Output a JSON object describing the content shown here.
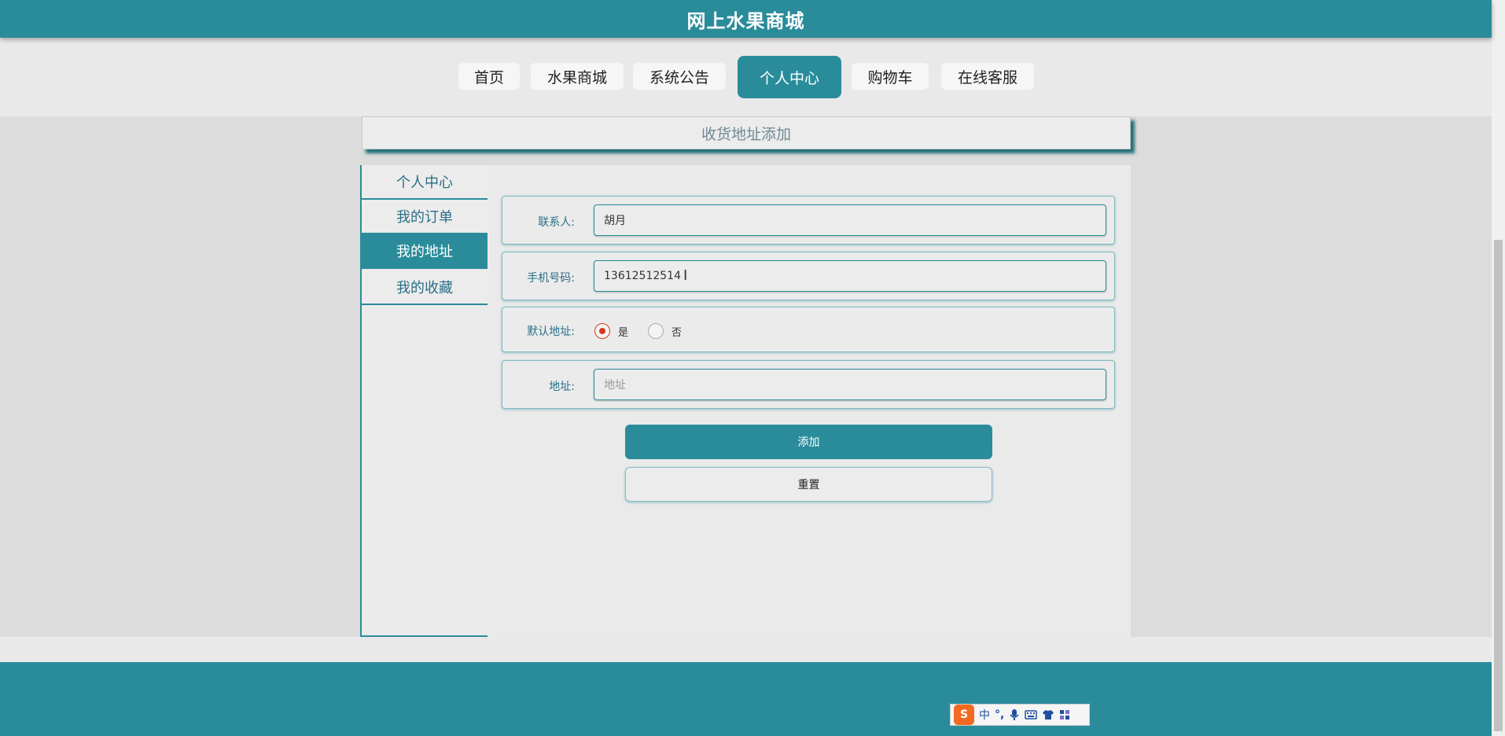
{
  "app": {
    "title": "网上水果商城"
  },
  "nav": {
    "items": [
      {
        "label": "首页"
      },
      {
        "label": "水果商城"
      },
      {
        "label": "系统公告"
      },
      {
        "label": "个人中心",
        "active": true
      },
      {
        "label": "购物车"
      },
      {
        "label": "在线客服"
      }
    ]
  },
  "page": {
    "heading": "收货地址添加"
  },
  "sidebar": {
    "items": [
      {
        "label": "个人中心"
      },
      {
        "label": "我的订单"
      },
      {
        "label": "我的地址",
        "active": true
      },
      {
        "label": "我的收藏"
      }
    ]
  },
  "form": {
    "contact": {
      "label": "联系人:",
      "value": "胡月"
    },
    "phone": {
      "label": "手机号码:",
      "value": "13612512514"
    },
    "default_address": {
      "label": "默认地址:",
      "options": [
        "是",
        "否"
      ],
      "selected": "是"
    },
    "address": {
      "label": "地址:",
      "value": "",
      "placeholder": "地址"
    },
    "submit_label": "添加",
    "reset_label": "重置"
  },
  "ime": {
    "logo": "S",
    "mode": "中",
    "punct": "°,"
  },
  "colors": {
    "primary": "#2a8c9b",
    "radio_checked": "#d9381e",
    "background": "#dcdcdc"
  }
}
